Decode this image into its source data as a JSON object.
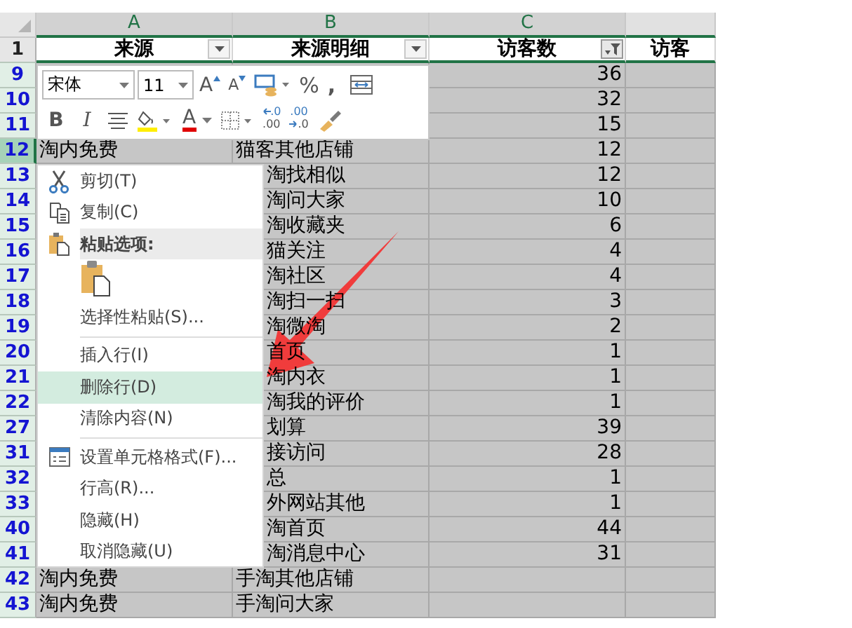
{
  "columns": [
    {
      "letter": "A",
      "selected": true
    },
    {
      "letter": "B",
      "selected": true
    },
    {
      "letter": "C",
      "selected": true
    }
  ],
  "header_row": {
    "number": "1",
    "cells": [
      {
        "text": "来源",
        "filtered": false
      },
      {
        "text": "来源明细",
        "filtered": false
      },
      {
        "text": "访客数",
        "filtered": true
      },
      {
        "text": "访客"
      }
    ]
  },
  "rows": [
    {
      "number": "9",
      "selected": false,
      "c": "36"
    },
    {
      "number": "10",
      "selected": false,
      "c": "32"
    },
    {
      "number": "11",
      "selected": false,
      "c": "15"
    },
    {
      "number": "12",
      "selected": true,
      "a": "淘内免费",
      "b": "猫客其他店铺",
      "c": "12"
    },
    {
      "number": "13",
      "selected": false,
      "b": "淘找相似",
      "c": "12"
    },
    {
      "number": "14",
      "selected": false,
      "b": "淘问大家",
      "c": "10"
    },
    {
      "number": "15",
      "selected": false,
      "b": "淘收藏夹",
      "c": "6"
    },
    {
      "number": "16",
      "selected": false,
      "b": "猫关注",
      "c": "4"
    },
    {
      "number": "17",
      "selected": false,
      "b": "淘社区",
      "c": "4"
    },
    {
      "number": "18",
      "selected": false,
      "b": "淘扫一扫",
      "c": "3"
    },
    {
      "number": "19",
      "selected": false,
      "b": "淘微淘",
      "c": "2"
    },
    {
      "number": "20",
      "selected": false,
      "b": "首页",
      "c": "1"
    },
    {
      "number": "21",
      "selected": false,
      "b": "淘内衣",
      "c": "1"
    },
    {
      "number": "22",
      "selected": false,
      "b": "淘我的评价",
      "c": "1"
    },
    {
      "number": "27",
      "selected": false,
      "b": "划算",
      "c": "39"
    },
    {
      "number": "31",
      "selected": false,
      "b": "接访问",
      "c": "28"
    },
    {
      "number": "32",
      "selected": false,
      "b": "总",
      "c": "1"
    },
    {
      "number": "33",
      "selected": false,
      "b": "外网站其他",
      "c": "1"
    },
    {
      "number": "40",
      "selected": false,
      "b": "淘首页",
      "c": "44"
    },
    {
      "number": "41",
      "selected": false,
      "b": "淘消息中心",
      "c": "31"
    },
    {
      "number": "42",
      "selected": false,
      "a": "淘内免费",
      "b": "手淘其他店铺"
    },
    {
      "number": "43",
      "selected": false,
      "a": "淘内免费",
      "b": "手淘问大家"
    }
  ],
  "mini_toolbar": {
    "font": "宋体",
    "size": "11",
    "buttons": [
      {
        "kind": "grow",
        "text": "A"
      },
      {
        "kind": "shrink",
        "text": "A"
      },
      {
        "kind": "accounting"
      },
      {
        "kind": "percent",
        "text": "%"
      },
      {
        "kind": "comma",
        "text": ","
      },
      {
        "kind": "wrap"
      }
    ],
    "buttons_2": [
      {
        "kind": "bold",
        "text": "B"
      },
      {
        "kind": "italic",
        "text": "I"
      },
      {
        "kind": "align"
      },
      {
        "kind": "fill"
      },
      {
        "kind": "fontcolor",
        "text": "A"
      },
      {
        "kind": "borders"
      },
      {
        "kind": "decinc",
        "text": ".0",
        "text2": ".00"
      },
      {
        "kind": "decdec",
        "text": ".00",
        "text2": ".0"
      },
      {
        "kind": "painter"
      }
    ]
  },
  "context_menu": [
    {
      "kind": "cut",
      "label": "剪切(T)",
      "selected": false
    },
    {
      "kind": "copy",
      "label": "复制(C)",
      "selected": false
    },
    {
      "kind": "paste_header",
      "label": "粘贴选项:"
    },
    {
      "kind": "paste_options"
    },
    {
      "kind": "item",
      "label": "选择性粘贴(S)...",
      "selected": false
    },
    {
      "kind": "separator"
    },
    {
      "kind": "item",
      "label": "插入行(I)",
      "selected": false
    },
    {
      "kind": "item",
      "label": "删除行(D)",
      "selected": true
    },
    {
      "kind": "item",
      "label": "清除内容(N)",
      "selected": false
    },
    {
      "kind": "separator"
    },
    {
      "kind": "format",
      "label": "设置单元格格式(F)...",
      "selected": false
    },
    {
      "kind": "item",
      "label": "行高(R)...",
      "selected": false
    },
    {
      "kind": "item",
      "label": "隐藏(H)",
      "selected": false
    },
    {
      "kind": "item",
      "label": "取消隐藏(U)",
      "selected": false
    }
  ],
  "annotation": {
    "kind": "arrow"
  }
}
